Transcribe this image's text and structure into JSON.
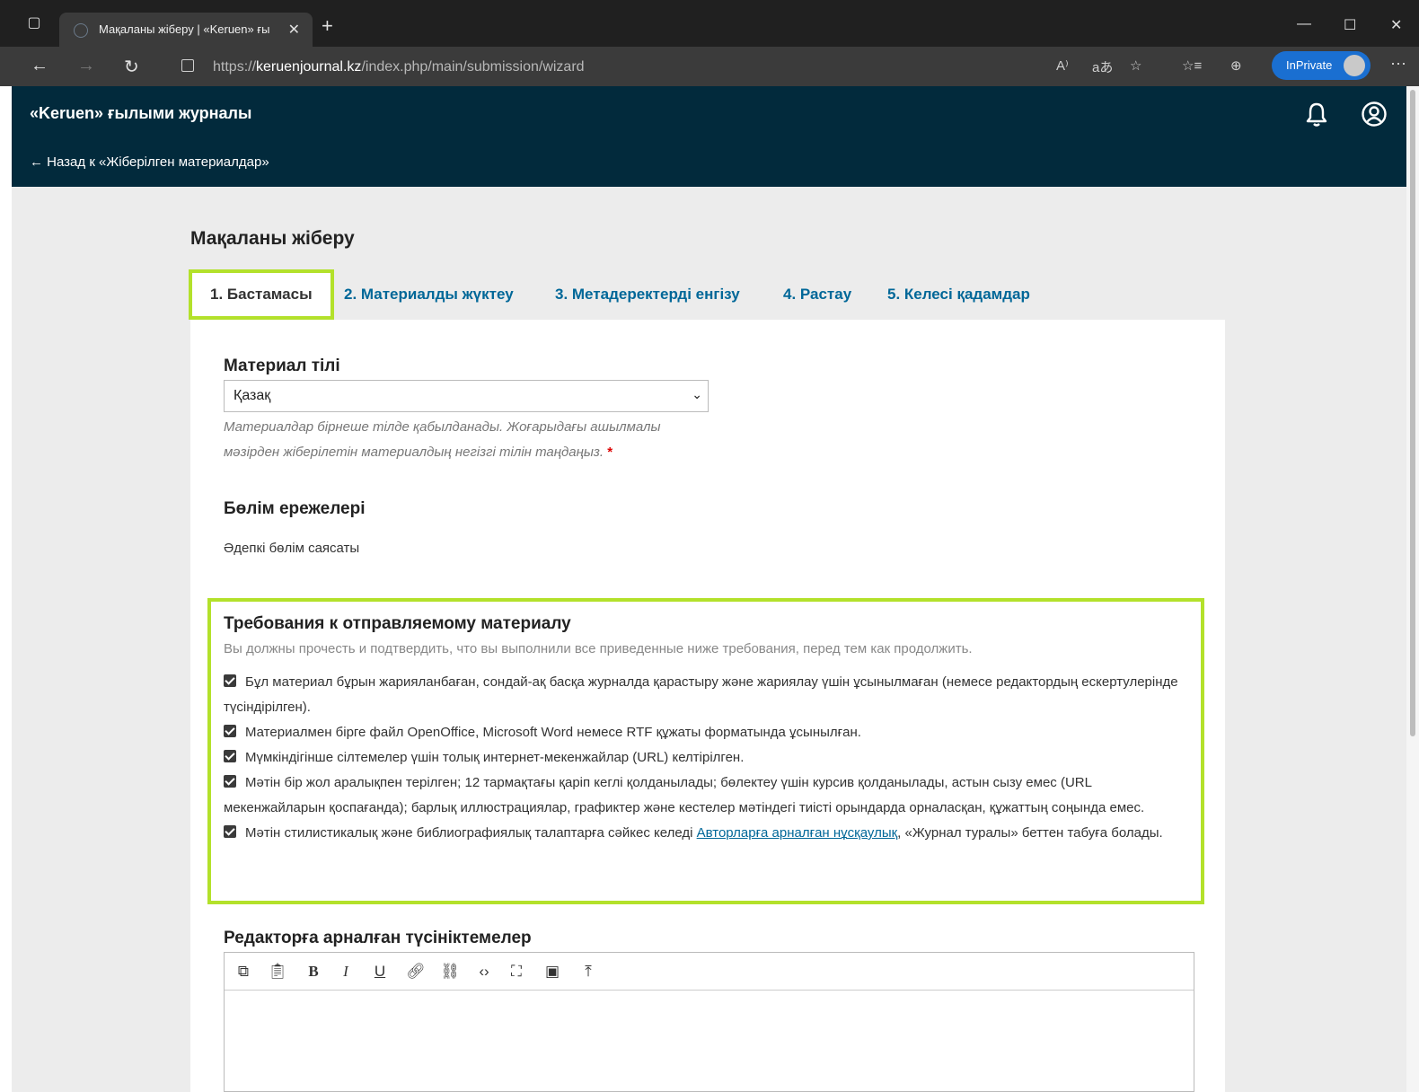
{
  "browser": {
    "tab_title": "Мақаланы жіберу | «Keruen» ғы",
    "url_prefix": "https://",
    "url_domain": "keruenjournal.kz",
    "url_path": "/index.php/main/submission/wizard",
    "inprivate_label": "InPrivate"
  },
  "header": {
    "site_title": "«Keruen» ғылыми журналы",
    "back_link": "← Назад к «Жіберілген материалдар»"
  },
  "page": {
    "heading": "Мақаланы жіберу"
  },
  "tabs": [
    {
      "label": "1. Бастамасы",
      "active": true
    },
    {
      "label": "2. Материалды жүктеу",
      "active": false
    },
    {
      "label": "3. Метадеректерді енгізу",
      "active": false
    },
    {
      "label": "4. Растау",
      "active": false
    },
    {
      "label": "5. Келесі қадамдар",
      "active": false
    }
  ],
  "language": {
    "label": "Материал тілі",
    "selected": "Қазақ",
    "help_line1": "Материалдар бірнеше тілде қабылданады. Жоғарыдағы ашылмалы",
    "help_line2": "мәзірден жіберілетін материалдың негізгі тілін таңдаңыз.",
    "required_mark": "*"
  },
  "section": {
    "label": "Бөлім ережелері",
    "policy": "Әдепкі бөлім саясаты"
  },
  "requirements": {
    "title": "Требования к отправляемому материалу",
    "subtitle": "Вы должны прочесть и подтвердить, что вы выполнили все приведенные ниже требования, перед тем как продолжить.",
    "items": [
      "Бұл материал бұрын жарияланбаған, сондай-ақ басқа журналда қарастыру және жариялау үшін ұсынылмаған (немесе редактордың ескертулерінде түсіндірілген).",
      "Материалмен бірге файл OpenOffice, Microsoft Word немесе RTF құжаты форматында ұсынылған.",
      "Мүмкіндігінше сілтемелер үшін толық интернет-мекенжайлар (URL) келтірілген.",
      "Мәтін бір жол аралықпен терілген; 12 тармақтағы қаріп кеглі қолданылады; бөлектеу үшін курсив қолданылады, астын сызу емес (URL мекенжайларын қоспағанда); барлық иллюстрациялар, графиктер және кестелер мәтіндегі тиісті орындарда орналасқан, құжаттың соңында емес."
    ],
    "last_item_before": "Мәтін стилистикалық және библиографиялық талаптарға сәйкес келеді ",
    "last_item_link": "Авторларға арналған нұсқаулық",
    "last_item_after": ", «Журнал туралы» беттен табуға болады."
  },
  "comments": {
    "label": "Редакторға арналған түсініктемелер"
  },
  "colors": {
    "header_bg": "#022a3c",
    "highlight": "#b3e12b",
    "link": "#006798"
  }
}
